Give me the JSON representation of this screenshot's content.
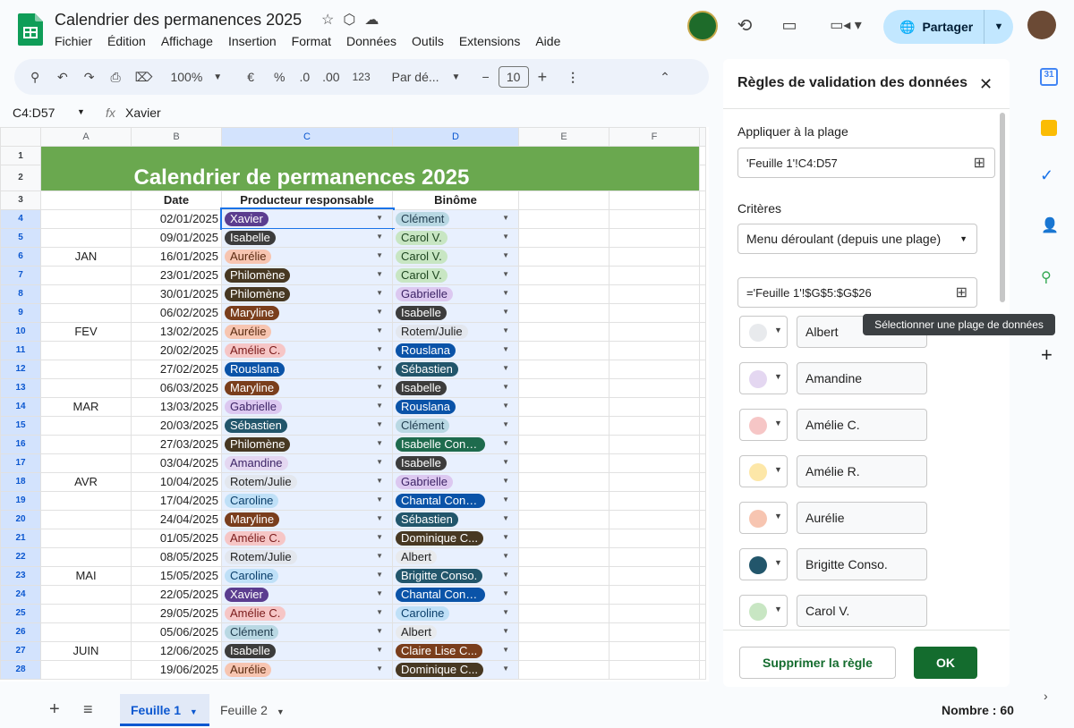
{
  "doc": {
    "title": "Calendrier des permanences 2025",
    "menu": [
      "Fichier",
      "Édition",
      "Affichage",
      "Insertion",
      "Format",
      "Données",
      "Outils",
      "Extensions",
      "Aide"
    ],
    "share_label": "Partager"
  },
  "toolbar": {
    "zoom": "100%",
    "currency": "€",
    "percent": "%",
    "dec_minus": ".0",
    "dec_plus": ".00",
    "numfmt": "123",
    "font": "Par dé...",
    "fontsize": "10"
  },
  "formula": {
    "namebox": "C4:D57",
    "fx": "fx",
    "value": "Xavier"
  },
  "sheet": {
    "columns": [
      "A",
      "B",
      "C",
      "D",
      "E",
      "F"
    ],
    "title": "Calendrier de permanences 2025",
    "headers": {
      "date": "Date",
      "prod": "Producteur responsable",
      "bin": "Binôme"
    },
    "months": [
      {
        "label": "JAN",
        "row": 6
      },
      {
        "label": "FEV",
        "row": 10
      },
      {
        "label": "MAR",
        "row": 14
      },
      {
        "label": "AVR",
        "row": 18
      },
      {
        "label": "MAI",
        "row": 23
      },
      {
        "label": "JUIN",
        "row": 27
      }
    ],
    "rows": [
      {
        "n": "4",
        "date": "02/01/2025",
        "p": "Xavier",
        "pc": "#5b3d8f",
        "pt": "#fff",
        "b": "Clément",
        "bc": "#b9d8e3",
        "bt": "#1f3b4d"
      },
      {
        "n": "5",
        "date": "09/01/2025",
        "p": "Isabelle",
        "pc": "#3c3c3c",
        "pt": "#fff",
        "b": "Carol V.",
        "bc": "#c8e6c3",
        "bt": "#1e4620"
      },
      {
        "n": "6",
        "date": "16/01/2025",
        "p": "Aurélie",
        "pc": "#f7c5b1",
        "pt": "#5a2a10",
        "b": "Carol V.",
        "bc": "#c8e6c3",
        "bt": "#1e4620"
      },
      {
        "n": "7",
        "date": "23/01/2025",
        "p": "Philomène",
        "pc": "#473822",
        "pt": "#fff",
        "b": "Carol V.",
        "bc": "#c8e6c3",
        "bt": "#1e4620"
      },
      {
        "n": "8",
        "date": "30/01/2025",
        "p": "Philomène",
        "pc": "#473822",
        "pt": "#fff",
        "b": "Gabrielle",
        "bc": "#dcc8f0",
        "bt": "#3d2466"
      },
      {
        "n": "9",
        "date": "06/02/2025",
        "p": "Maryline",
        "pc": "#7a3e1c",
        "pt": "#fff",
        "b": "Isabelle",
        "bc": "#3c3c3c",
        "bt": "#fff"
      },
      {
        "n": "10",
        "date": "13/02/2025",
        "p": "Aurélie",
        "pc": "#f7c5b1",
        "pt": "#5a2a10",
        "b": "Rotem/Julie",
        "bc": "#e3e7ee",
        "bt": "#1f1f1f"
      },
      {
        "n": "11",
        "date": "20/02/2025",
        "p": "Amélie C.",
        "pc": "#f6c6c6",
        "pt": "#7a1b1b",
        "b": "Rouslana",
        "bc": "#0a53a8",
        "bt": "#fff"
      },
      {
        "n": "12",
        "date": "27/02/2025",
        "p": "Rouslana",
        "pc": "#0a53a8",
        "pt": "#fff",
        "b": "Sébastien",
        "bc": "#22566b",
        "bt": "#fff"
      },
      {
        "n": "13",
        "date": "06/03/2025",
        "p": "Maryline",
        "pc": "#7a3e1c",
        "pt": "#fff",
        "b": "Isabelle",
        "bc": "#3c3c3c",
        "bt": "#fff"
      },
      {
        "n": "14",
        "date": "13/03/2025",
        "p": "Gabrielle",
        "pc": "#dcc8f0",
        "pt": "#3d2466",
        "b": "Rouslana",
        "bc": "#0a53a8",
        "bt": "#fff"
      },
      {
        "n": "15",
        "date": "20/03/2025",
        "p": "Sébastien",
        "pc": "#22566b",
        "pt": "#fff",
        "b": "Clément",
        "bc": "#b9d8e3",
        "bt": "#1f3b4d"
      },
      {
        "n": "16",
        "date": "27/03/2025",
        "p": "Philomène",
        "pc": "#473822",
        "pt": "#fff",
        "b": "Isabelle Conso.",
        "bc": "#1e6b4d",
        "bt": "#fff"
      },
      {
        "n": "17",
        "date": "03/04/2025",
        "p": "Amandine",
        "pc": "#e4d7f1",
        "pt": "#3d2466",
        "b": "Isabelle",
        "bc": "#3c3c3c",
        "bt": "#fff"
      },
      {
        "n": "18",
        "date": "10/04/2025",
        "p": "Rotem/Julie",
        "pc": "#e3e7ee",
        "pt": "#1f1f1f",
        "b": "Gabrielle",
        "bc": "#dcc8f0",
        "bt": "#3d2466"
      },
      {
        "n": "19",
        "date": "17/04/2025",
        "p": "Caroline",
        "pc": "#bfe0f7",
        "pt": "#0b3f6b",
        "b": "Chantal Conso.",
        "bc": "#0a53a8",
        "bt": "#fff"
      },
      {
        "n": "20",
        "date": "24/04/2025",
        "p": "Maryline",
        "pc": "#7a3e1c",
        "pt": "#fff",
        "b": "Sébastien",
        "bc": "#22566b",
        "bt": "#fff"
      },
      {
        "n": "21",
        "date": "01/05/2025",
        "p": "Amélie C.",
        "pc": "#f6c6c6",
        "pt": "#7a1b1b",
        "b": "Dominique C...",
        "bc": "#473822",
        "bt": "#fff"
      },
      {
        "n": "22",
        "date": "08/05/2025",
        "p": "Rotem/Julie",
        "pc": "#e3e7ee",
        "pt": "#1f1f1f",
        "b": "Albert",
        "bc": "#e8eaed",
        "bt": "#1f1f1f"
      },
      {
        "n": "23",
        "date": "15/05/2025",
        "p": "Caroline",
        "pc": "#bfe0f7",
        "pt": "#0b3f6b",
        "b": "Brigitte Conso.",
        "bc": "#22566b",
        "bt": "#fff"
      },
      {
        "n": "24",
        "date": "22/05/2025",
        "p": "Xavier",
        "pc": "#5b3d8f",
        "pt": "#fff",
        "b": "Chantal Conso.",
        "bc": "#0a53a8",
        "bt": "#fff"
      },
      {
        "n": "25",
        "date": "29/05/2025",
        "p": "Amélie C.",
        "pc": "#f6c6c6",
        "pt": "#7a1b1b",
        "b": "Caroline",
        "bc": "#bfe0f7",
        "bt": "#0b3f6b"
      },
      {
        "n": "26",
        "date": "05/06/2025",
        "p": "Clément",
        "pc": "#b9d8e3",
        "pt": "#1f3b4d",
        "b": "Albert",
        "bc": "#e8eaed",
        "bt": "#1f1f1f"
      },
      {
        "n": "27",
        "date": "12/06/2025",
        "p": "Isabelle",
        "pc": "#3c3c3c",
        "pt": "#fff",
        "b": "Claire Lise C...",
        "bc": "#7a3e1c",
        "bt": "#fff"
      },
      {
        "n": "28",
        "date": "19/06/2025",
        "p": "Aurélie",
        "pc": "#f7c5b1",
        "pt": "#5a2a10",
        "b": "Dominique C...",
        "bc": "#473822",
        "bt": "#fff"
      }
    ]
  },
  "panel": {
    "title": "Règles de validation des données",
    "apply_label": "Appliquer à la plage",
    "range": "'Feuille 1'!C4:D57",
    "criteria_label": "Critères",
    "criteria": "Menu déroulant (depuis une plage)",
    "formula": "='Feuille 1'!$G$5:$G$26",
    "tooltip": "Sélectionner une plage de données",
    "options": [
      {
        "label": "Albert",
        "color": "#e8eaed"
      },
      {
        "label": "Amandine",
        "color": "#e4d7f1"
      },
      {
        "label": "Amélie C.",
        "color": "#f6c6c6"
      },
      {
        "label": "Amélie R.",
        "color": "#fde7a8"
      },
      {
        "label": "Aurélie",
        "color": "#f7c5b1"
      },
      {
        "label": "Brigitte Conso.",
        "color": "#22566b"
      },
      {
        "label": "Carol V.",
        "color": "#c8e6c3"
      }
    ],
    "delete_label": "Supprimer la règle",
    "ok_label": "OK"
  },
  "tabs": {
    "sheet1": "Feuille 1",
    "sheet2": "Feuille 2",
    "status": "Nombre : 60"
  }
}
